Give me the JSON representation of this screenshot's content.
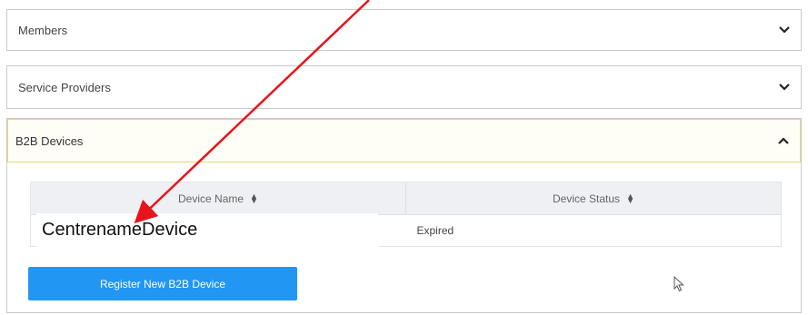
{
  "panels": {
    "members": {
      "title": "Members"
    },
    "service_providers": {
      "title": "Service Providers"
    },
    "b2b_devices": {
      "title": "B2B Devices"
    }
  },
  "table": {
    "columns": [
      "Device Name",
      "Device Status"
    ],
    "rows": [
      {
        "device_name": "",
        "device_status": "Expired"
      }
    ]
  },
  "annotation": {
    "device_name_label": "CentrenameDevice",
    "arrow_color": "#e8141b"
  },
  "register_button": {
    "label": "Register New B2B Device"
  },
  "colors": {
    "primary_button": "#2196f3",
    "header_bg": "#eef0f3",
    "active_border": "#e8d77a"
  }
}
